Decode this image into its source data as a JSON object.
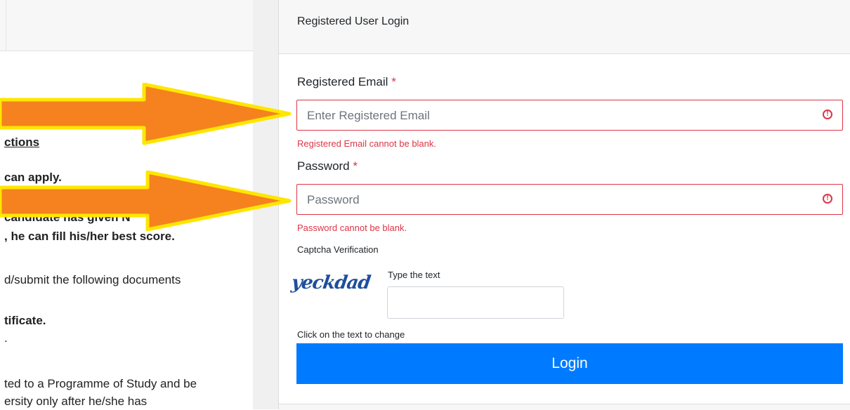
{
  "instructions": {
    "line1": "ctions",
    "line2": "can apply.",
    "line3": "candidate has given N",
    "line4": ", he can fill his/her best score.",
    "line5": "d/submit the following documents",
    "line6": "tificate.",
    "line7": ".",
    "line8": "ted to a Programme of Study and be",
    "line9": "ersity only after he/she has"
  },
  "login": {
    "header": "Registered User Login",
    "email_label": "Registered Email",
    "required_mark": "*",
    "email_placeholder": "Enter Registered Email",
    "email_error": "Registered Email cannot be blank.",
    "password_label": "Password",
    "password_placeholder": "Password",
    "password_error": "Password cannot be blank.",
    "captcha_title": "Captcha Verification",
    "captcha_text": "yeckdad",
    "type_label": "Type the text",
    "captcha_value": "",
    "change_hint": "Click on the text to change",
    "submit_label": "Login",
    "error_icon_glyph": "!"
  },
  "colors": {
    "error": "#dc3545",
    "primary": "#007bff",
    "arrow_fill": "#f5821f",
    "arrow_outline": "#ffe600"
  }
}
